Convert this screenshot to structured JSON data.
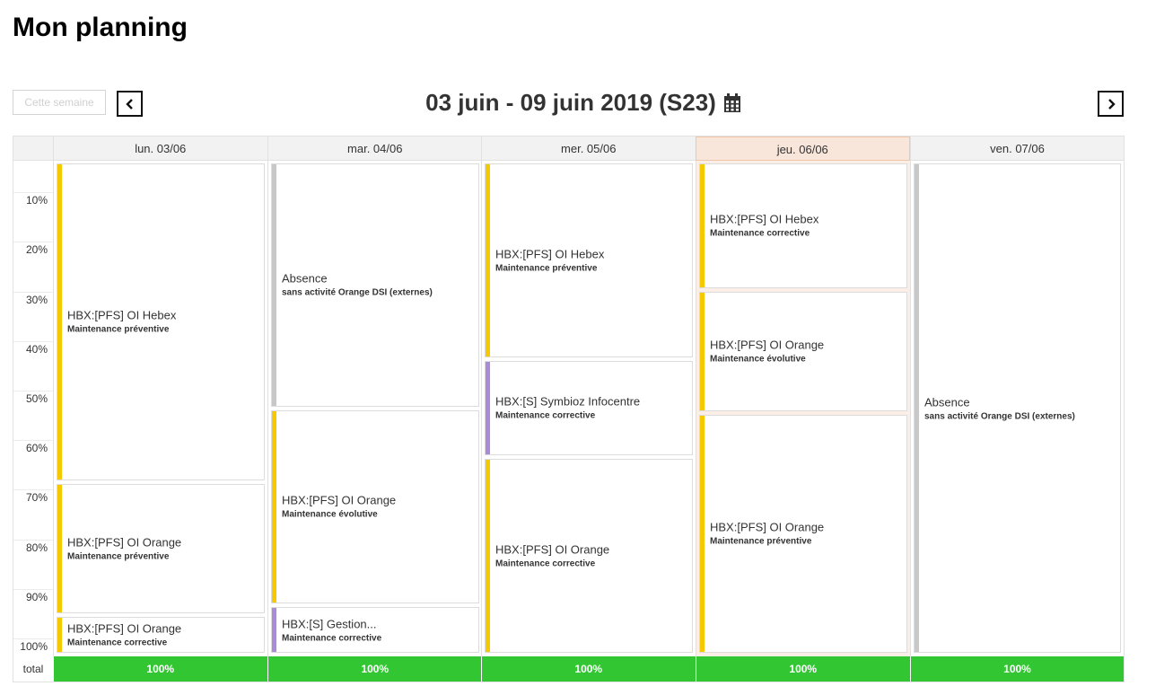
{
  "page": {
    "title": "Mon planning"
  },
  "toolbar": {
    "this_week_label": "Cette semaine",
    "prev_icon": "chevron-left-icon",
    "next_icon": "chevron-right-icon",
    "week_label": "03 juin - 09 juin 2019 (S23)",
    "calendar_icon": "calendar-icon"
  },
  "axis": {
    "labels": [
      "10%",
      "20%",
      "30%",
      "40%",
      "50%",
      "60%",
      "70%",
      "80%",
      "90%",
      "100%"
    ],
    "total_label": "total"
  },
  "colors": {
    "hebex": "#f5c800",
    "orange": "#f5c800",
    "absence": "#c8c8c8",
    "s_project": "#a98bd8",
    "total_bg": "#33c633",
    "today_header": "#f8e6db"
  },
  "days": [
    {
      "label": "lun. 03/06",
      "today": false,
      "total": "100%",
      "events": [
        {
          "title": "HBX:[PFS] OI Hebex",
          "subtitle": "Maintenance préventive",
          "percent": 65,
          "color": "#f5c800"
        },
        {
          "title": "HBX:[PFS] OI Orange",
          "subtitle": "Maintenance préventive",
          "percent": 27,
          "color": "#f5c800"
        },
        {
          "title": "HBX:[PFS] OI Orange",
          "subtitle": "Maintenance corrective",
          "percent": 8,
          "color": "#f5c800"
        }
      ]
    },
    {
      "label": "mar. 04/06",
      "today": false,
      "total": "100%",
      "events": [
        {
          "title": "Absence",
          "subtitle": "sans activité Orange DSI (externes)",
          "percent": 50,
          "color": "#c8c8c8"
        },
        {
          "title": "HBX:[PFS] OI Orange",
          "subtitle": "Maintenance évolutive",
          "percent": 40,
          "color": "#f5c800"
        },
        {
          "title": "HBX:[S] Gestion...",
          "subtitle": "Maintenance corrective",
          "percent": 10,
          "color": "#a98bd8"
        }
      ]
    },
    {
      "label": "mer. 05/06",
      "today": false,
      "total": "100%",
      "events": [
        {
          "title": "HBX:[PFS] OI Hebex",
          "subtitle": "Maintenance préventive",
          "percent": 40,
          "color": "#f5c800"
        },
        {
          "title": "HBX:[S] Symbioz Infocentre",
          "subtitle": "Maintenance corrective",
          "percent": 20,
          "color": "#a98bd8"
        },
        {
          "title": "HBX:[PFS] OI Orange",
          "subtitle": "Maintenance corrective",
          "percent": 40,
          "color": "#f5c800"
        }
      ]
    },
    {
      "label": "jeu. 06/06",
      "today": true,
      "total": "100%",
      "events": [
        {
          "title": "HBX:[PFS] OI Hebex",
          "subtitle": "Maintenance corrective",
          "percent": 26,
          "color": "#f5c800"
        },
        {
          "title": "HBX:[PFS] OI Orange",
          "subtitle": "Maintenance évolutive",
          "percent": 25,
          "color": "#f5c800"
        },
        {
          "title": "HBX:[PFS] OI Orange",
          "subtitle": "Maintenance préventive",
          "percent": 49,
          "color": "#f5c800"
        }
      ]
    },
    {
      "label": "ven. 07/06",
      "today": false,
      "total": "100%",
      "events": [
        {
          "title": "Absence",
          "subtitle": "sans activité Orange DSI (externes)",
          "percent": 100,
          "color": "#c8c8c8"
        }
      ]
    }
  ]
}
